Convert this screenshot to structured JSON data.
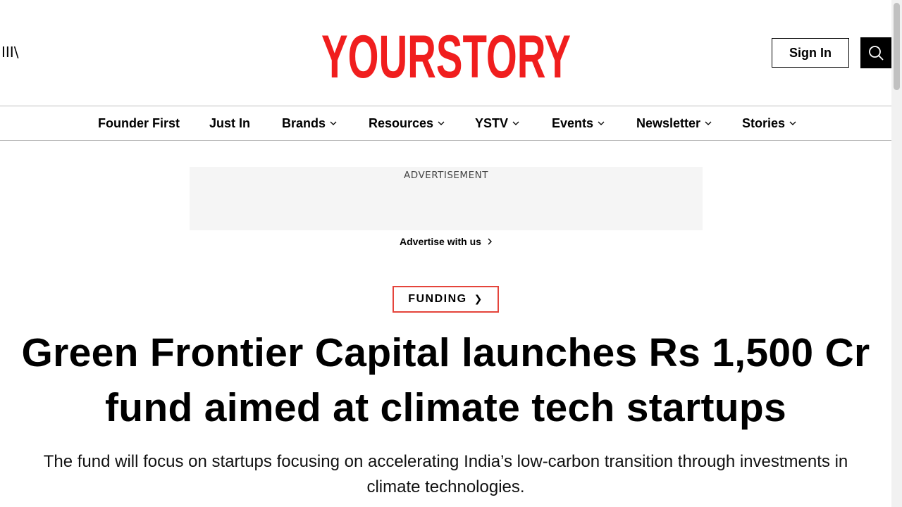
{
  "header": {
    "menu_label": "III\\",
    "logo_text": "YOURSTORY",
    "signin_label": "Sign In"
  },
  "nav": {
    "items": [
      {
        "label": "Founder First",
        "has_dropdown": false
      },
      {
        "label": "Just In",
        "has_dropdown": false
      },
      {
        "label": "Brands",
        "has_dropdown": true
      },
      {
        "label": "Resources",
        "has_dropdown": true
      },
      {
        "label": "YSTV",
        "has_dropdown": true
      },
      {
        "label": "Events",
        "has_dropdown": true
      },
      {
        "label": "Newsletter",
        "has_dropdown": true
      },
      {
        "label": "Stories",
        "has_dropdown": true
      }
    ]
  },
  "ad": {
    "label": "ADVERTISEMENT",
    "advertise_link": "Advertise with us"
  },
  "article": {
    "category": "FUNDING",
    "category_chevron": "❯",
    "headline": "Green Frontier Capital launches Rs 1,500 Cr fund aimed at climate tech startups",
    "subhead": "The fund will focus on startups focusing on accelerating India’s low-carbon transition through investments in climate technologies."
  },
  "colors": {
    "brand_red": "#f01e1e",
    "tag_border": "#e5443b",
    "text": "#000000",
    "ad_bg": "#f5f5f5"
  },
  "icons": {
    "menu": "hamburger-text-icon",
    "search": "search-icon",
    "dropdown": "chevron-down-icon",
    "advertise_arrow": "chevron-right-icon"
  }
}
